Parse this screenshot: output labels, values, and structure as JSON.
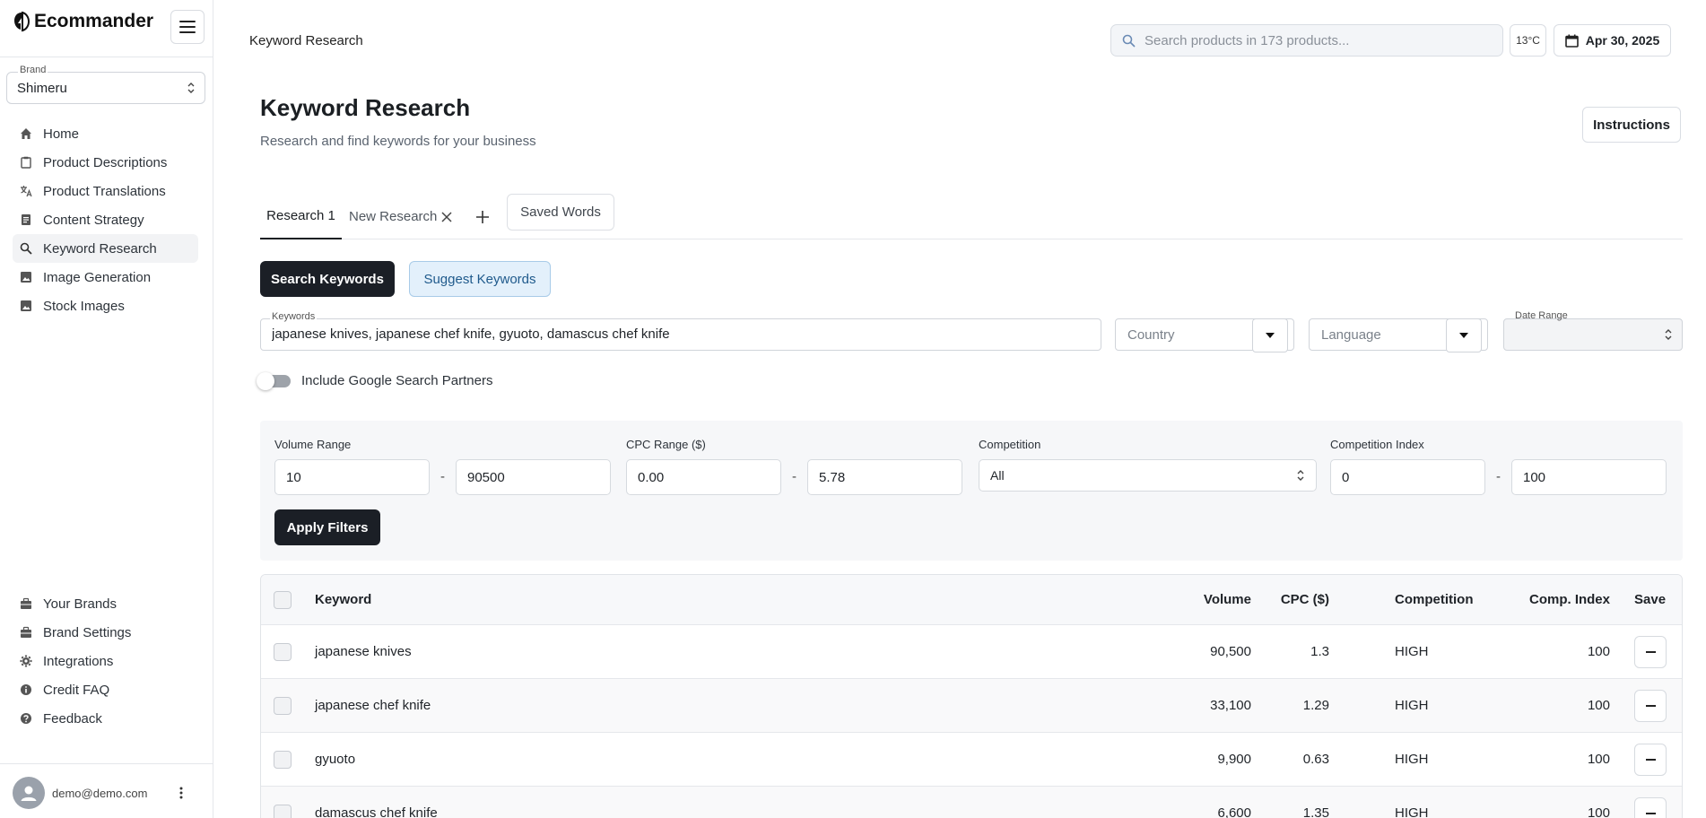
{
  "app": {
    "name": "Ecommander"
  },
  "sidebar": {
    "brand_label": "Brand",
    "brand_value": "Shimeru",
    "nav_top": [
      {
        "label": "Home",
        "icon": "home-icon"
      },
      {
        "label": "Product Descriptions",
        "icon": "clipboard-icon"
      },
      {
        "label": "Product Translations",
        "icon": "translate-icon"
      },
      {
        "label": "Content Strategy",
        "icon": "document-icon"
      },
      {
        "label": "Keyword Research",
        "icon": "search-icon",
        "active": true
      },
      {
        "label": "Image Generation",
        "icon": "image-icon"
      },
      {
        "label": "Stock Images",
        "icon": "image-icon"
      }
    ],
    "nav_bottom": [
      {
        "label": "Your Brands",
        "icon": "briefcase-icon"
      },
      {
        "label": "Brand Settings",
        "icon": "briefcase-icon"
      },
      {
        "label": "Integrations",
        "icon": "gear-icon"
      },
      {
        "label": "Credit FAQ",
        "icon": "info-icon"
      },
      {
        "label": "Feedback",
        "icon": "help-icon"
      }
    ],
    "user_email": "demo@demo.com"
  },
  "topbar": {
    "breadcrumb": "Keyword Research",
    "search_placeholder": "Search products in 173 products...",
    "temperature": "13°C",
    "date": "Apr 30, 2025"
  },
  "header": {
    "title": "Keyword Research",
    "subtitle": "Research and find keywords for your business",
    "instructions_label": "Instructions"
  },
  "tabs": {
    "items": [
      {
        "label": "Research 1",
        "active": true
      },
      {
        "label": "New Research",
        "active": false
      }
    ],
    "saved_words_label": "Saved Words"
  },
  "actions": {
    "search_label": "Search Keywords",
    "suggest_label": "Suggest Keywords"
  },
  "inputs": {
    "keywords_label": "Keywords",
    "keywords_value": "japanese knives, japanese chef knife, gyuoto, damascus chef knife",
    "country_placeholder": "Country",
    "language_placeholder": "Language",
    "date_range_label": "Date Range",
    "google_partners_label": "Include Google Search Partners"
  },
  "filters": {
    "volume_label": "Volume Range",
    "volume_min": "10",
    "volume_max": "90500",
    "cpc_label": "CPC Range ($)",
    "cpc_min": "0.00",
    "cpc_max": "5.78",
    "competition_label": "Competition",
    "competition_value": "All",
    "index_label": "Competition Index",
    "index_min": "0",
    "index_max": "100",
    "range_separator": "-",
    "apply_label": "Apply Filters"
  },
  "table": {
    "headers": {
      "keyword": "Keyword",
      "volume": "Volume",
      "cpc": "CPC ($)",
      "competition": "Competition",
      "index": "Comp. Index",
      "save": "Save"
    },
    "rows": [
      {
        "keyword": "japanese knives",
        "volume": "90,500",
        "cpc": "1.3",
        "competition": "HIGH",
        "index": "100"
      },
      {
        "keyword": "japanese chef knife",
        "volume": "33,100",
        "cpc": "1.29",
        "competition": "HIGH",
        "index": "100"
      },
      {
        "keyword": "gyuoto",
        "volume": "9,900",
        "cpc": "0.63",
        "competition": "HIGH",
        "index": "100"
      },
      {
        "keyword": "damascus chef knife",
        "volume": "6,600",
        "cpc": "1.35",
        "competition": "HIGH",
        "index": "100"
      }
    ]
  }
}
